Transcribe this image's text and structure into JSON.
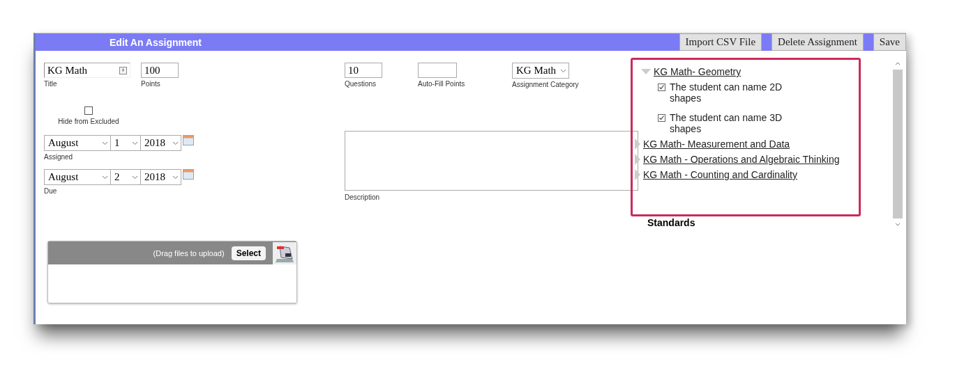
{
  "window": {
    "title": "Edit An Assignment"
  },
  "toolbar_buttons": [
    {
      "label": "Import CSV File"
    },
    {
      "label": "Delete Assignment"
    },
    {
      "label": "Save"
    }
  ],
  "title_field": {
    "value": "KG Math",
    "label": "Title"
  },
  "points_field": {
    "value": "100",
    "label": "Points"
  },
  "hide_from_excluded": {
    "label": "Hide from Excluded",
    "checked": false
  },
  "dates": [
    {
      "month": "August",
      "day": "1",
      "year": "2018",
      "label": "Assigned"
    },
    {
      "month": "August",
      "day": "2",
      "year": "2018",
      "label": "Due"
    }
  ],
  "questions_field": {
    "value": "10",
    "label": "Questions"
  },
  "auto_fill_field": {
    "label": "Auto-Fill Points"
  },
  "category": {
    "value": "KG Math",
    "label": "Assignment Category"
  },
  "description": {
    "label": "Description"
  },
  "upload": {
    "hint": "(Drag files to upload)",
    "button": "Select"
  },
  "standards": {
    "label": "Standards",
    "items": [
      {
        "label": "KG Math- Geometry",
        "expanded": true,
        "children": [
          {
            "label": "The student can name 2D shapes",
            "checked": true
          },
          {
            "label": "The student can name 3D shapes",
            "checked": true
          }
        ]
      },
      {
        "label": "KG Math- Measurement and Data",
        "expanded": false
      },
      {
        "label": "KG Math - Operations and Algebraic Thinking",
        "expanded": false
      },
      {
        "label": "KG Math - Counting and Cardinality",
        "expanded": false
      }
    ]
  }
}
